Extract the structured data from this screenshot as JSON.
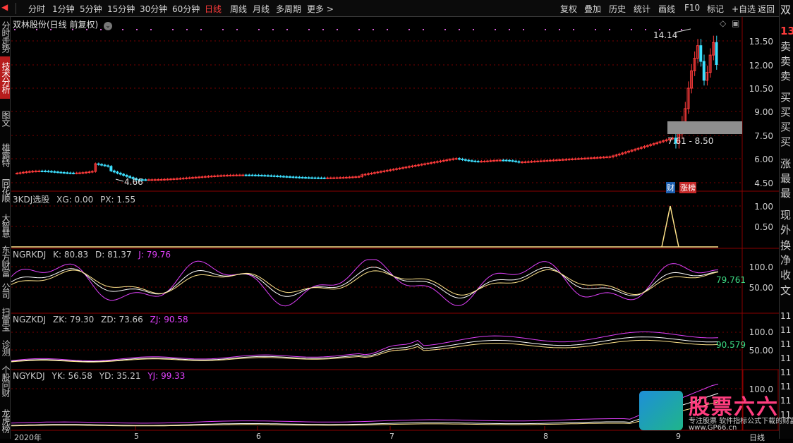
{
  "toolbar": {
    "items": [
      "分时",
      "1分钟",
      "5分钟",
      "15分钟",
      "30分钟",
      "60分钟",
      "日线",
      "周线",
      "月线",
      "多周期",
      "更多 >"
    ],
    "active": "日线",
    "right_items": [
      "复权",
      "叠加",
      "历史",
      "统计",
      "画线",
      "F10",
      "标记",
      "+自选",
      "返回"
    ]
  },
  "left_tabs": [
    "分时走势",
    "技术分析",
    "图文F10",
    "雄霸特",
    "同花顺",
    "大智慧",
    "东方财富",
    "公司",
    "扫雷宝",
    "诊测",
    "个股问财",
    "龙虎榜"
  ],
  "left_tab_active": "技术分析",
  "right_strip": {
    "title": "双",
    "price": "13",
    "labels": [
      "卖",
      "卖",
      "卖",
      "买",
      "买",
      "买",
      "买",
      "涨",
      "最",
      "最",
      "现",
      "外",
      "换",
      "净",
      "收",
      "文",
      "11",
      "11",
      "11",
      "11",
      "11",
      "11",
      "11",
      "11"
    ]
  },
  "main_chart": {
    "title": "双林股份(日线 前复权)",
    "y_ticks": [
      "13.50",
      "12.00",
      "10.50",
      "9.00",
      "7.50",
      "6.00",
      "4.50"
    ],
    "high_label": "14.14",
    "low_label": "4.66",
    "range_label": "7.61 - 8.50",
    "badge_cai": "财",
    "badge_zhangbang": "涨榜"
  },
  "indicators": [
    {
      "name": "3KDJ选股",
      "labels": [
        {
          "text": "XG: 0.00",
          "color": "#cfcfcf"
        },
        {
          "text": "PX: 1.55",
          "color": "#cfcfcf"
        }
      ],
      "y_ticks": [
        "1.00",
        "0.50"
      ],
      "last_value": ""
    },
    {
      "name": "NGRKDJ",
      "labels": [
        {
          "text": "K: 80.83",
          "color": "#cfcfcf"
        },
        {
          "text": "D: 81.37",
          "color": "#cfcfcf"
        },
        {
          "text": "J: 79.76",
          "color": "#e040fb"
        }
      ],
      "y_ticks": [
        "100.0",
        "50.00"
      ],
      "last_value": "79.761"
    },
    {
      "name": "NGZKDJ",
      "labels": [
        {
          "text": "ZK: 79.30",
          "color": "#cfcfcf"
        },
        {
          "text": "ZD: 73.66",
          "color": "#cfcfcf"
        },
        {
          "text": "ZJ: 90.58",
          "color": "#e040fb"
        }
      ],
      "y_ticks": [
        "100.0",
        "50.00"
      ],
      "last_value": "90.579"
    },
    {
      "name": "NGYKDJ",
      "labels": [
        {
          "text": "YK: 56.58",
          "color": "#cfcfcf"
        },
        {
          "text": "YD: 35.21",
          "color": "#cfcfcf"
        },
        {
          "text": "YJ: 99.33",
          "color": "#e040fb"
        }
      ],
      "y_ticks": [
        "100.0"
      ],
      "last_value": ""
    }
  ],
  "x_axis": [
    "2020年",
    "5",
    "6",
    "7",
    "8",
    "9",
    "日线"
  ],
  "watermark": {
    "title": "股票六六",
    "line1": "专注股票 软件指标公式下载的财富",
    "line2": "www.GP66.cn"
  },
  "colors": {
    "up": "#ff3b3b",
    "down": "#3de0ff",
    "k_line": "#ffffff",
    "d_line": "#ffe38a",
    "j_line": "#e040fb",
    "grid": "#7a0000"
  }
}
